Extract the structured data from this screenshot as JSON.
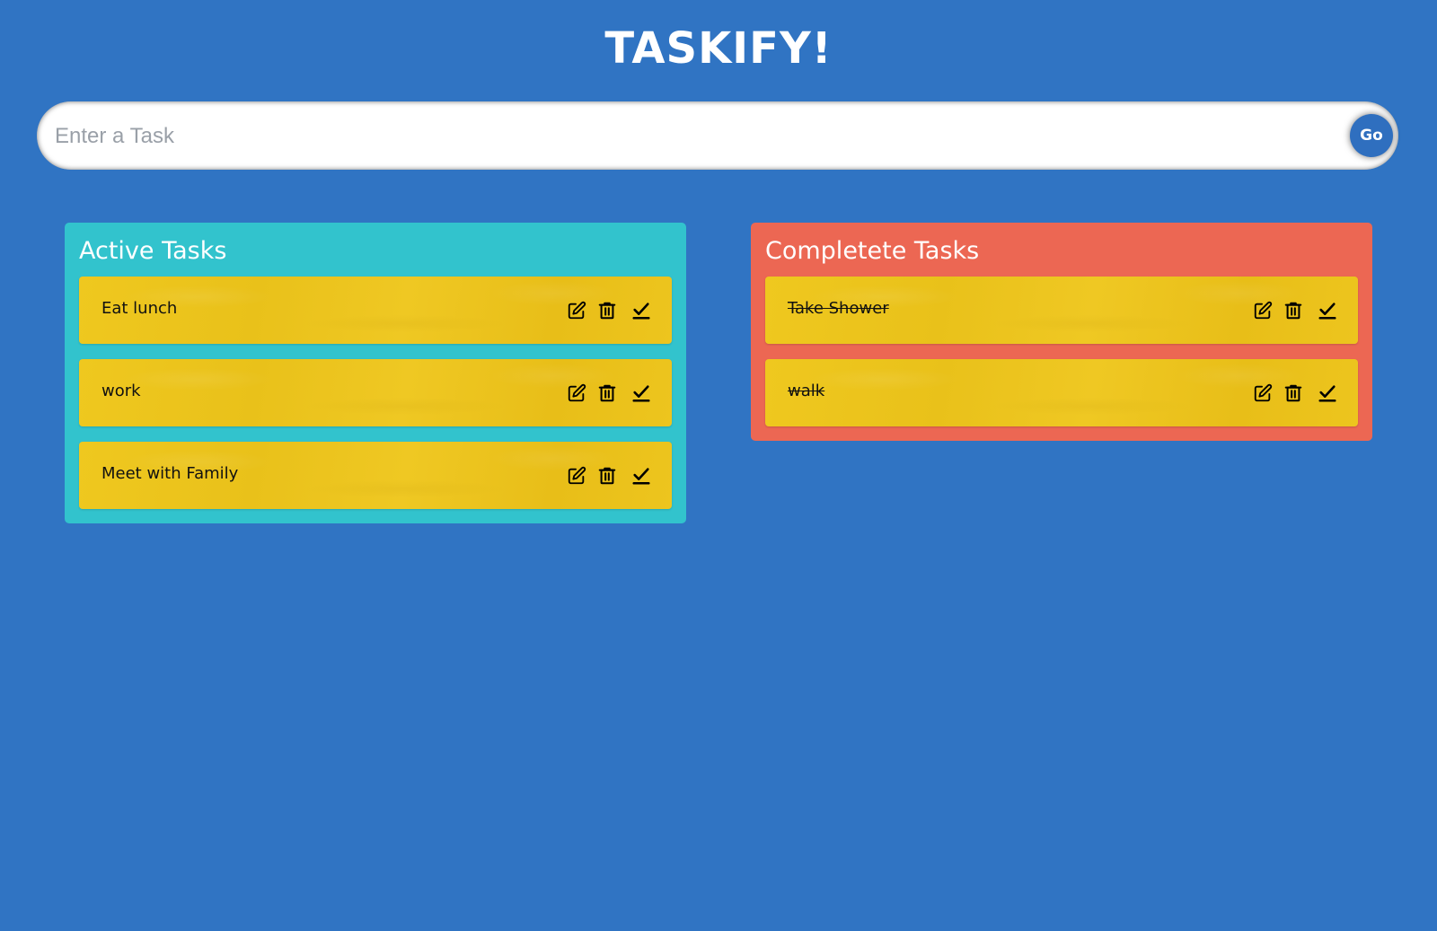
{
  "app": {
    "title": "TASKIFY!"
  },
  "form": {
    "placeholder": "Enter a Task",
    "value": "",
    "submit_label": "Go"
  },
  "colors": {
    "background": "#3074c3",
    "active_panel": "#32c3cd",
    "completed_panel": "#ec6753",
    "task_card": "#edc51e"
  },
  "active": {
    "heading": "Active Tasks",
    "tasks": [
      {
        "text": "Eat lunch",
        "icons": [
          "edit-icon",
          "delete-icon",
          "check-icon"
        ]
      },
      {
        "text": "work",
        "icons": [
          "edit-icon",
          "delete-icon",
          "check-icon"
        ]
      },
      {
        "text": "Meet with Family",
        "icons": [
          "edit-icon",
          "delete-icon",
          "check-icon"
        ]
      }
    ]
  },
  "completed": {
    "heading": "Completete Tasks",
    "tasks": [
      {
        "text": "Take Shower",
        "icons": [
          "edit-icon",
          "delete-icon",
          "check-icon"
        ]
      },
      {
        "text": "walk",
        "icons": [
          "edit-icon",
          "delete-icon",
          "check-icon"
        ]
      }
    ]
  }
}
